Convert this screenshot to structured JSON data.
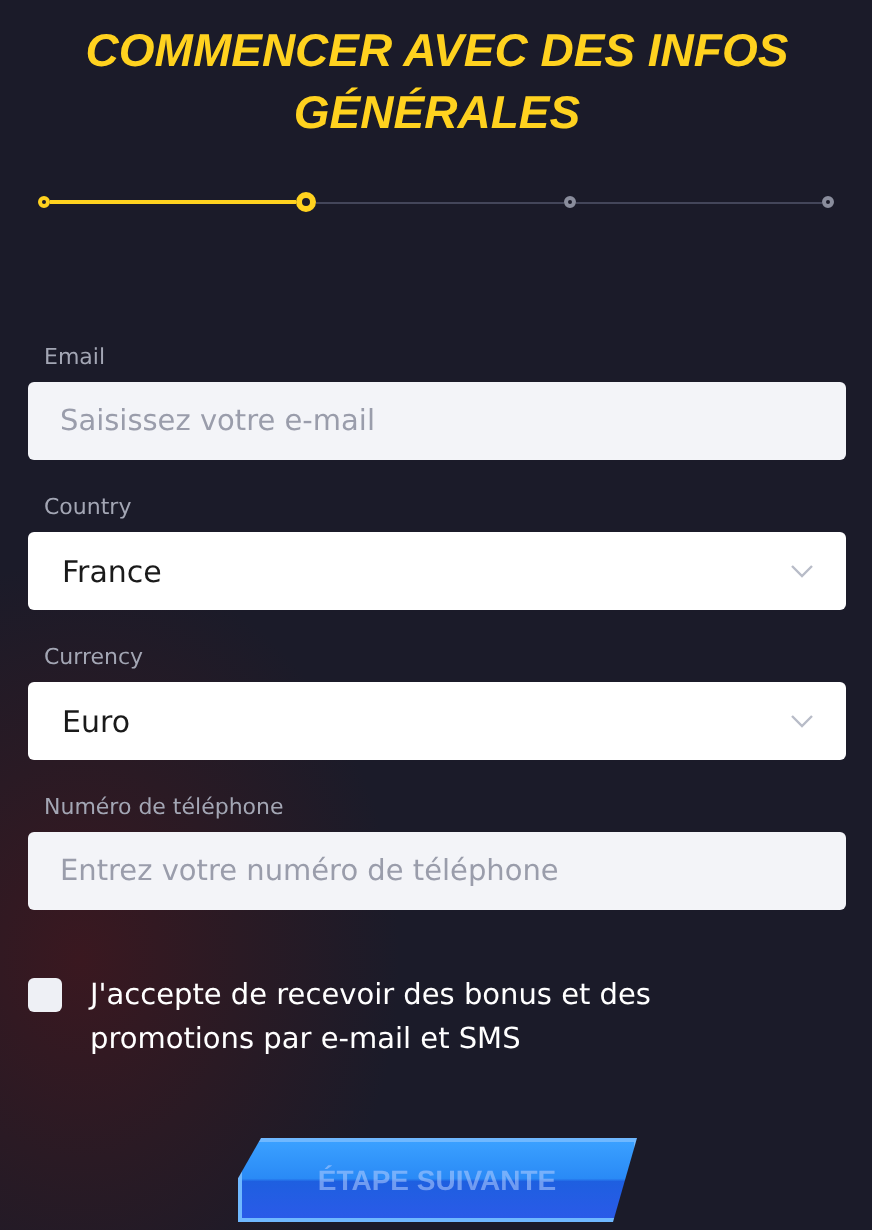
{
  "title": "COMMENCER AVEC DES INFOS GÉNÉRALES",
  "steps": [
    {
      "done": true,
      "selected": false
    },
    {
      "done": false,
      "selected": true
    },
    {
      "done": false,
      "selected": false
    },
    {
      "done": false,
      "selected": false
    }
  ],
  "fields": [
    {
      "kind": "text",
      "label": "Email",
      "placeholder": "Saisissez votre e-mail"
    },
    {
      "kind": "select",
      "label": "Country",
      "value": "France"
    },
    {
      "kind": "select",
      "label": "Currency",
      "value": "Euro"
    },
    {
      "kind": "text",
      "label": "Numéro de téléphone",
      "placeholder": "Entrez votre numéro de téléphone"
    }
  ],
  "consent": {
    "label": "J'accepte de recevoir des bonus et des promotions par e-mail et SMS",
    "checked": false
  },
  "next_button": {
    "label": "ÉTAPE SUIVANTE",
    "disabled": true
  }
}
